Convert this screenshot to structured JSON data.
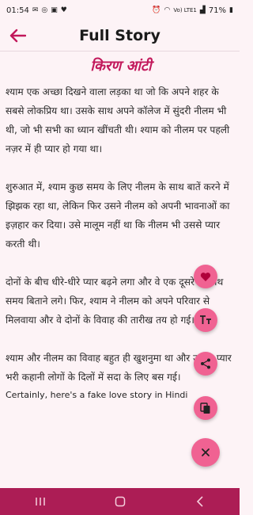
{
  "status": {
    "time": "01:54",
    "battery": "71%",
    "network_label": "Vo) LTE1",
    "icons": [
      "mail-icon",
      "whatsapp-icon",
      "image-icon",
      "heart-icon",
      "alarm-icon",
      "wifi-icon",
      "signal-icon",
      "battery-icon"
    ]
  },
  "app_bar": {
    "title": "Full Story",
    "back_icon": "arrow-left-icon"
  },
  "story": {
    "title": "किरण आंटी",
    "paragraphs": [
      "श्याम एक अच्छा दिखने वाला लड़का था जो कि अपने शहर के सबसे लोकप्रिय था। उसके साथ अपने कॉलेज में सुंदरी नीलम भी थी, जो भी सभी का ध्यान खींचती थी। श्याम को नीलम पर पहली नज़र में ही प्यार हो गया था।",
      "शुरुआत में, श्याम कुछ समय के लिए नीलम के साथ बातें करने में झिझक रहा था, लेकिन फिर उसने नीलम को अपनी भावनाओं का इज़हार कर दिया। उसे मालूम नहीं था कि नीलम भी उससे प्यार करती थी।",
      "दोनों के बीच धीरे-धीरे प्यार बढ़ने लगा और वे एक दूसरे के साथ समय बिताने लगे। फिर, श्याम ने नीलम को अपने परिवार से मिलवाया और वे दोनों के विवाह की तारीख तय हो गई।",
      "श्याम और नीलम का विवाह बहुत ही खुशनुमा था और उनकी प्यार भरी कहानी लोगों के दिलों में सदा के लिए बस गई।"
    ],
    "footer_text": "Certainly, here's a fake love story in Hindi"
  },
  "fabs": [
    {
      "name": "favorite",
      "icon": "heart-icon"
    },
    {
      "name": "text-size",
      "icon": "text-size-icon"
    },
    {
      "name": "share",
      "icon": "share-icon"
    },
    {
      "name": "copy",
      "icon": "copy-icon"
    },
    {
      "name": "close",
      "icon": "close-icon"
    }
  ],
  "colors": {
    "accent": "#c2185b",
    "fab": "#f06292",
    "nav_bar": "#ac1d55",
    "background": "#fdf3f6"
  }
}
